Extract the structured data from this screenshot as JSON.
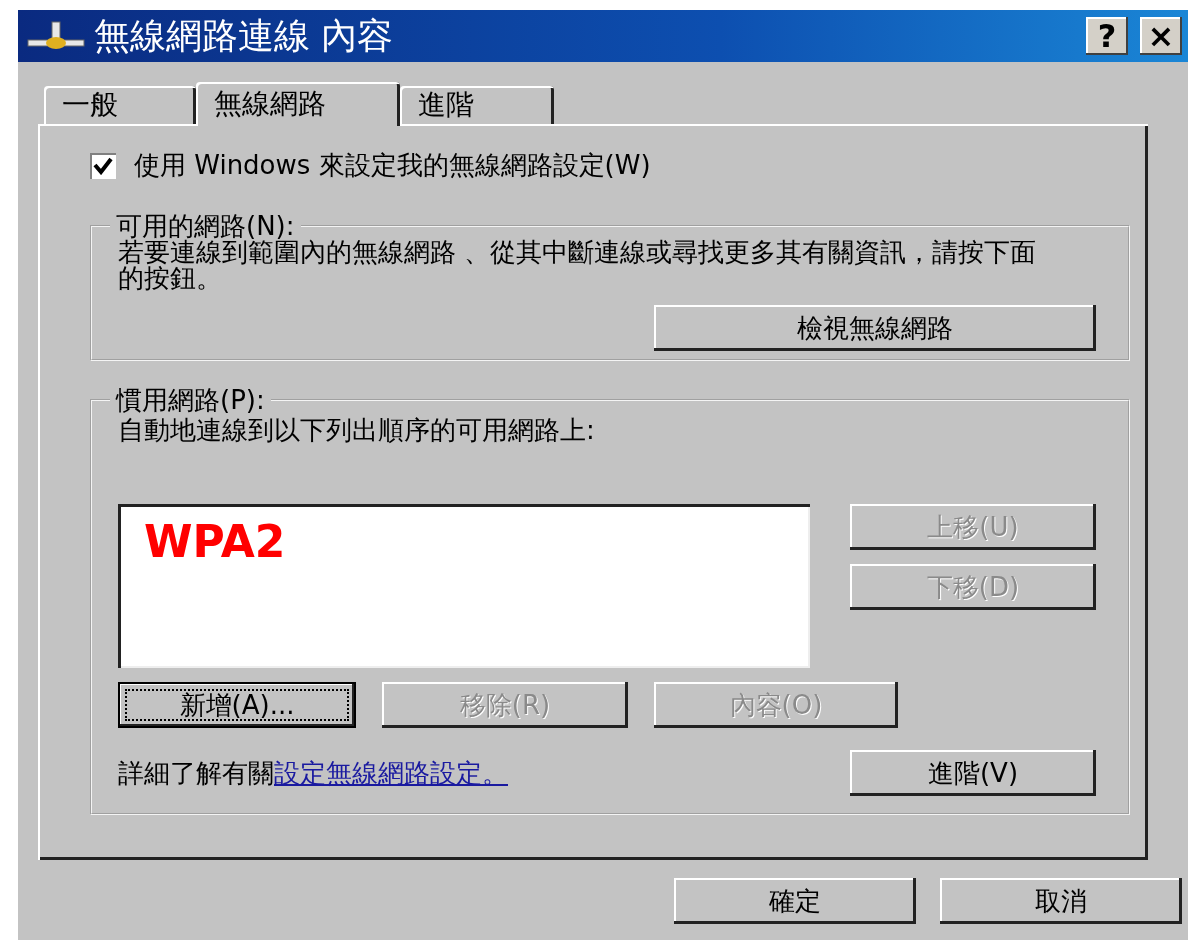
{
  "window": {
    "title": "無線網路連線 內容",
    "controls": [
      "?",
      "×"
    ]
  },
  "tabs": [
    {
      "label": "一般",
      "selected": false
    },
    {
      "label": "無線網路",
      "selected": true
    },
    {
      "label": "進階",
      "selected": false
    }
  ],
  "use_windows": {
    "label": "使用 Windows 來設定我的無線網路設定(W)",
    "checked": true
  },
  "available_networks": {
    "title": "可用的網路(N):",
    "description": "若要連線到範圍內的無線網路 、從其中斷連線或尋找更多其有關資訊，請按下面的按鈕。",
    "button": "檢視無線網路"
  },
  "preferred_networks": {
    "title": "慣用網路(P):",
    "description": "自動地連線到以下列出順序的可用網路上:",
    "list": [
      "WPA2"
    ],
    "move_buttons": [
      {
        "label": "上移(U)",
        "disabled": true
      },
      {
        "label": "下移(D)",
        "disabled": true
      }
    ],
    "action_buttons": [
      {
        "label": "新增(A)...",
        "disabled": false,
        "focused": true
      },
      {
        "label": "移除(R)",
        "disabled": true,
        "focused": false
      },
      {
        "label": "內容(O)",
        "disabled": true,
        "focused": false
      }
    ],
    "learn_more": {
      "text": "詳細了解有關",
      "link": "設定無線網路設定。"
    },
    "advanced_button": "進階(V)"
  },
  "footer_buttons": [
    "確定",
    "取消"
  ]
}
